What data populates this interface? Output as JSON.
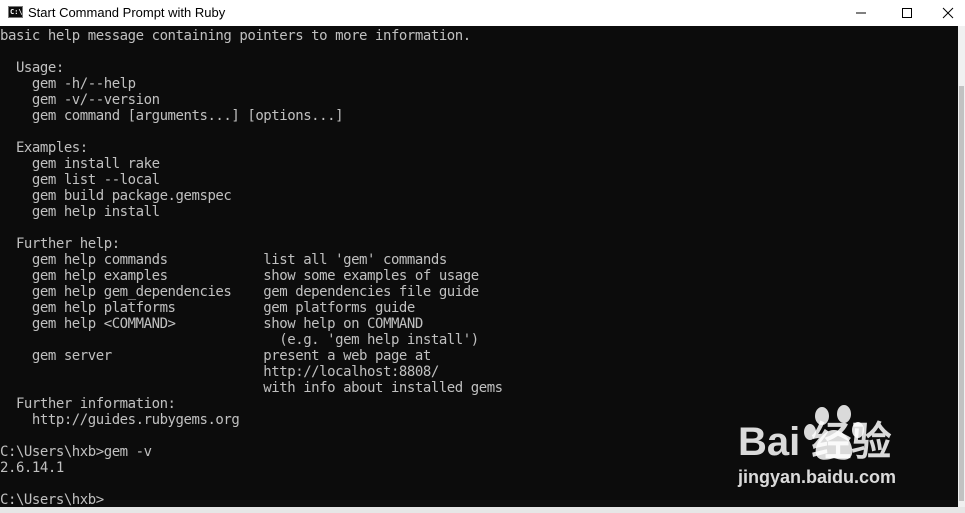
{
  "window": {
    "title": "Start Command Prompt with Ruby",
    "icon_label": "C:\\"
  },
  "console": {
    "lines": [
      "basic help message containing pointers to more information.",
      "",
      "  Usage:",
      "    gem -h/--help",
      "    gem -v/--version",
      "    gem command [arguments...] [options...]",
      "",
      "  Examples:",
      "    gem install rake",
      "    gem list --local",
      "    gem build package.gemspec",
      "    gem help install",
      "",
      "  Further help:",
      "    gem help commands            list all 'gem' commands",
      "    gem help examples            show some examples of usage",
      "    gem help gem_dependencies    gem dependencies file guide",
      "    gem help platforms           gem platforms guide",
      "    gem help <COMMAND>           show help on COMMAND",
      "                                   (e.g. 'gem help install')",
      "    gem server                   present a web page at",
      "                                 http://localhost:8808/",
      "                                 with info about installed gems",
      "  Further information:",
      "    http://guides.rubygems.org",
      "",
      "C:\\Users\\hxb>gem -v",
      "2.6.14.1",
      "",
      "C:\\Users\\hxb>"
    ]
  },
  "watermark": {
    "logo_text": "Bai 经验",
    "url": "jingyan.baidu.com"
  },
  "icons": {
    "minimize": "minimize-icon",
    "maximize": "maximize-icon",
    "close": "close-icon",
    "paw": "baidu-paw-icon"
  }
}
